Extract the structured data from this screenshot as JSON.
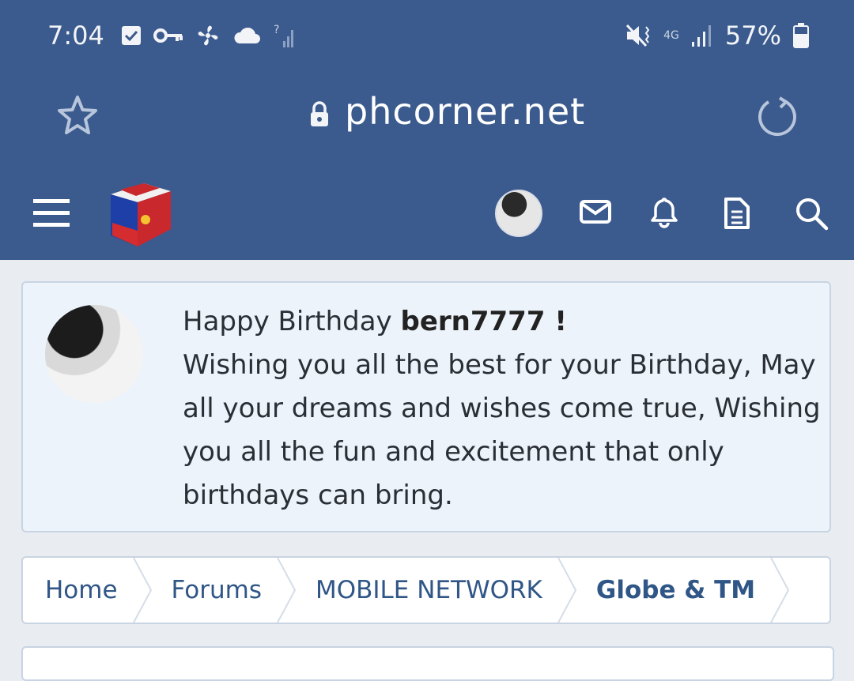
{
  "status_bar": {
    "time": "7:04",
    "network": "4G",
    "battery": "57%"
  },
  "browser": {
    "url": "phcorner.net"
  },
  "birthday": {
    "greeting": "Happy Birthday ",
    "username": "bern7777",
    "exclaim": " !",
    "message": "Wishing you all the best for your Birthday, May all your dreams and wishes come true, Wishing you all the fun and excitement that only birthdays can bring."
  },
  "breadcrumbs": [
    {
      "label": "Home"
    },
    {
      "label": "Forums"
    },
    {
      "label": "MOBILE NETWORK"
    },
    {
      "label": "Globe & TM"
    }
  ],
  "colors": {
    "header_bg": "#3b5a8d",
    "page_bg": "#e9ecf0",
    "link": "#2f5686"
  }
}
